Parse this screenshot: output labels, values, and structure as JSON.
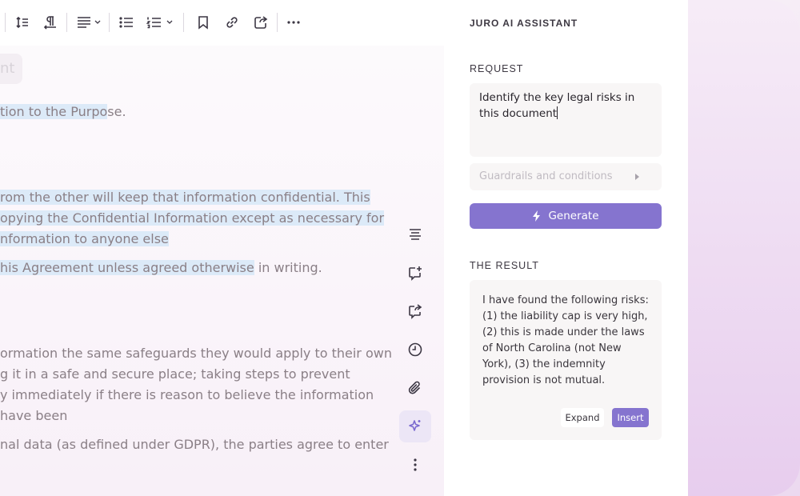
{
  "document": {
    "ghost_chip": "nt",
    "lines": [
      {
        "text": "tion to the Purpose.",
        "hl": "tion to the Purpo"
      },
      {
        "text": "rom the other will keep that information confidential. This",
        "hl": "rom the other will keep that information confidential. This"
      },
      {
        "text": "opying the Confidential Information except as necessary for",
        "hl": "opying the Confidential Information except as necessary for"
      },
      {
        "text": "nformation to anyone else",
        "hl": "nformation to anyone else"
      },
      {
        "text": "his Agreement unless agreed otherwise in writing.",
        "hl": "his Agreement unless agreed otherwise"
      },
      {
        "text": "ormation the same safeguards they would apply to their own",
        "hl": ""
      },
      {
        "text": "g it in a safe and secure place; taking steps to prevent",
        "hl": ""
      },
      {
        "text": "y immediately if there is reason to believe the information",
        "hl": ""
      },
      {
        "text": "have been",
        "hl": ""
      },
      {
        "text": "nal data (as defined under GDPR), the parties agree to enter",
        "hl": ""
      }
    ]
  },
  "toolbar": {
    "icons": [
      "line-spacing-icon",
      "paragraph-direction-icon",
      "align-icon",
      "bullet-list-icon",
      "numbered-list-icon",
      "bookmark-icon",
      "link-icon",
      "share-icon",
      "more-icon"
    ]
  },
  "rail": {
    "icons": [
      "outline-icon",
      "add-comment-icon",
      "share-doc-icon",
      "history-icon",
      "attachment-icon",
      "ai-sparkle-icon",
      "more-vertical-icon"
    ],
    "active": "ai-sparkle-icon"
  },
  "assistant": {
    "title": "JURO AI ASSISTANT",
    "request_label": "REQUEST",
    "request_text": "Identify the key legal risks in this document",
    "guardrails_placeholder": "Guardrails and conditions",
    "generate_label": "Generate",
    "result_label": "THE RESULT",
    "result_text": "I have found the following risks: (1) the liability cap is very high, (2) this is made under the laws of North Carolina (not New York), (3) the indemnity provision is not mutual.",
    "expand_label": "Expand",
    "insert_label": "Insert"
  },
  "colors": {
    "accent": "#8574cf",
    "highlight": "#dceaf8"
  }
}
